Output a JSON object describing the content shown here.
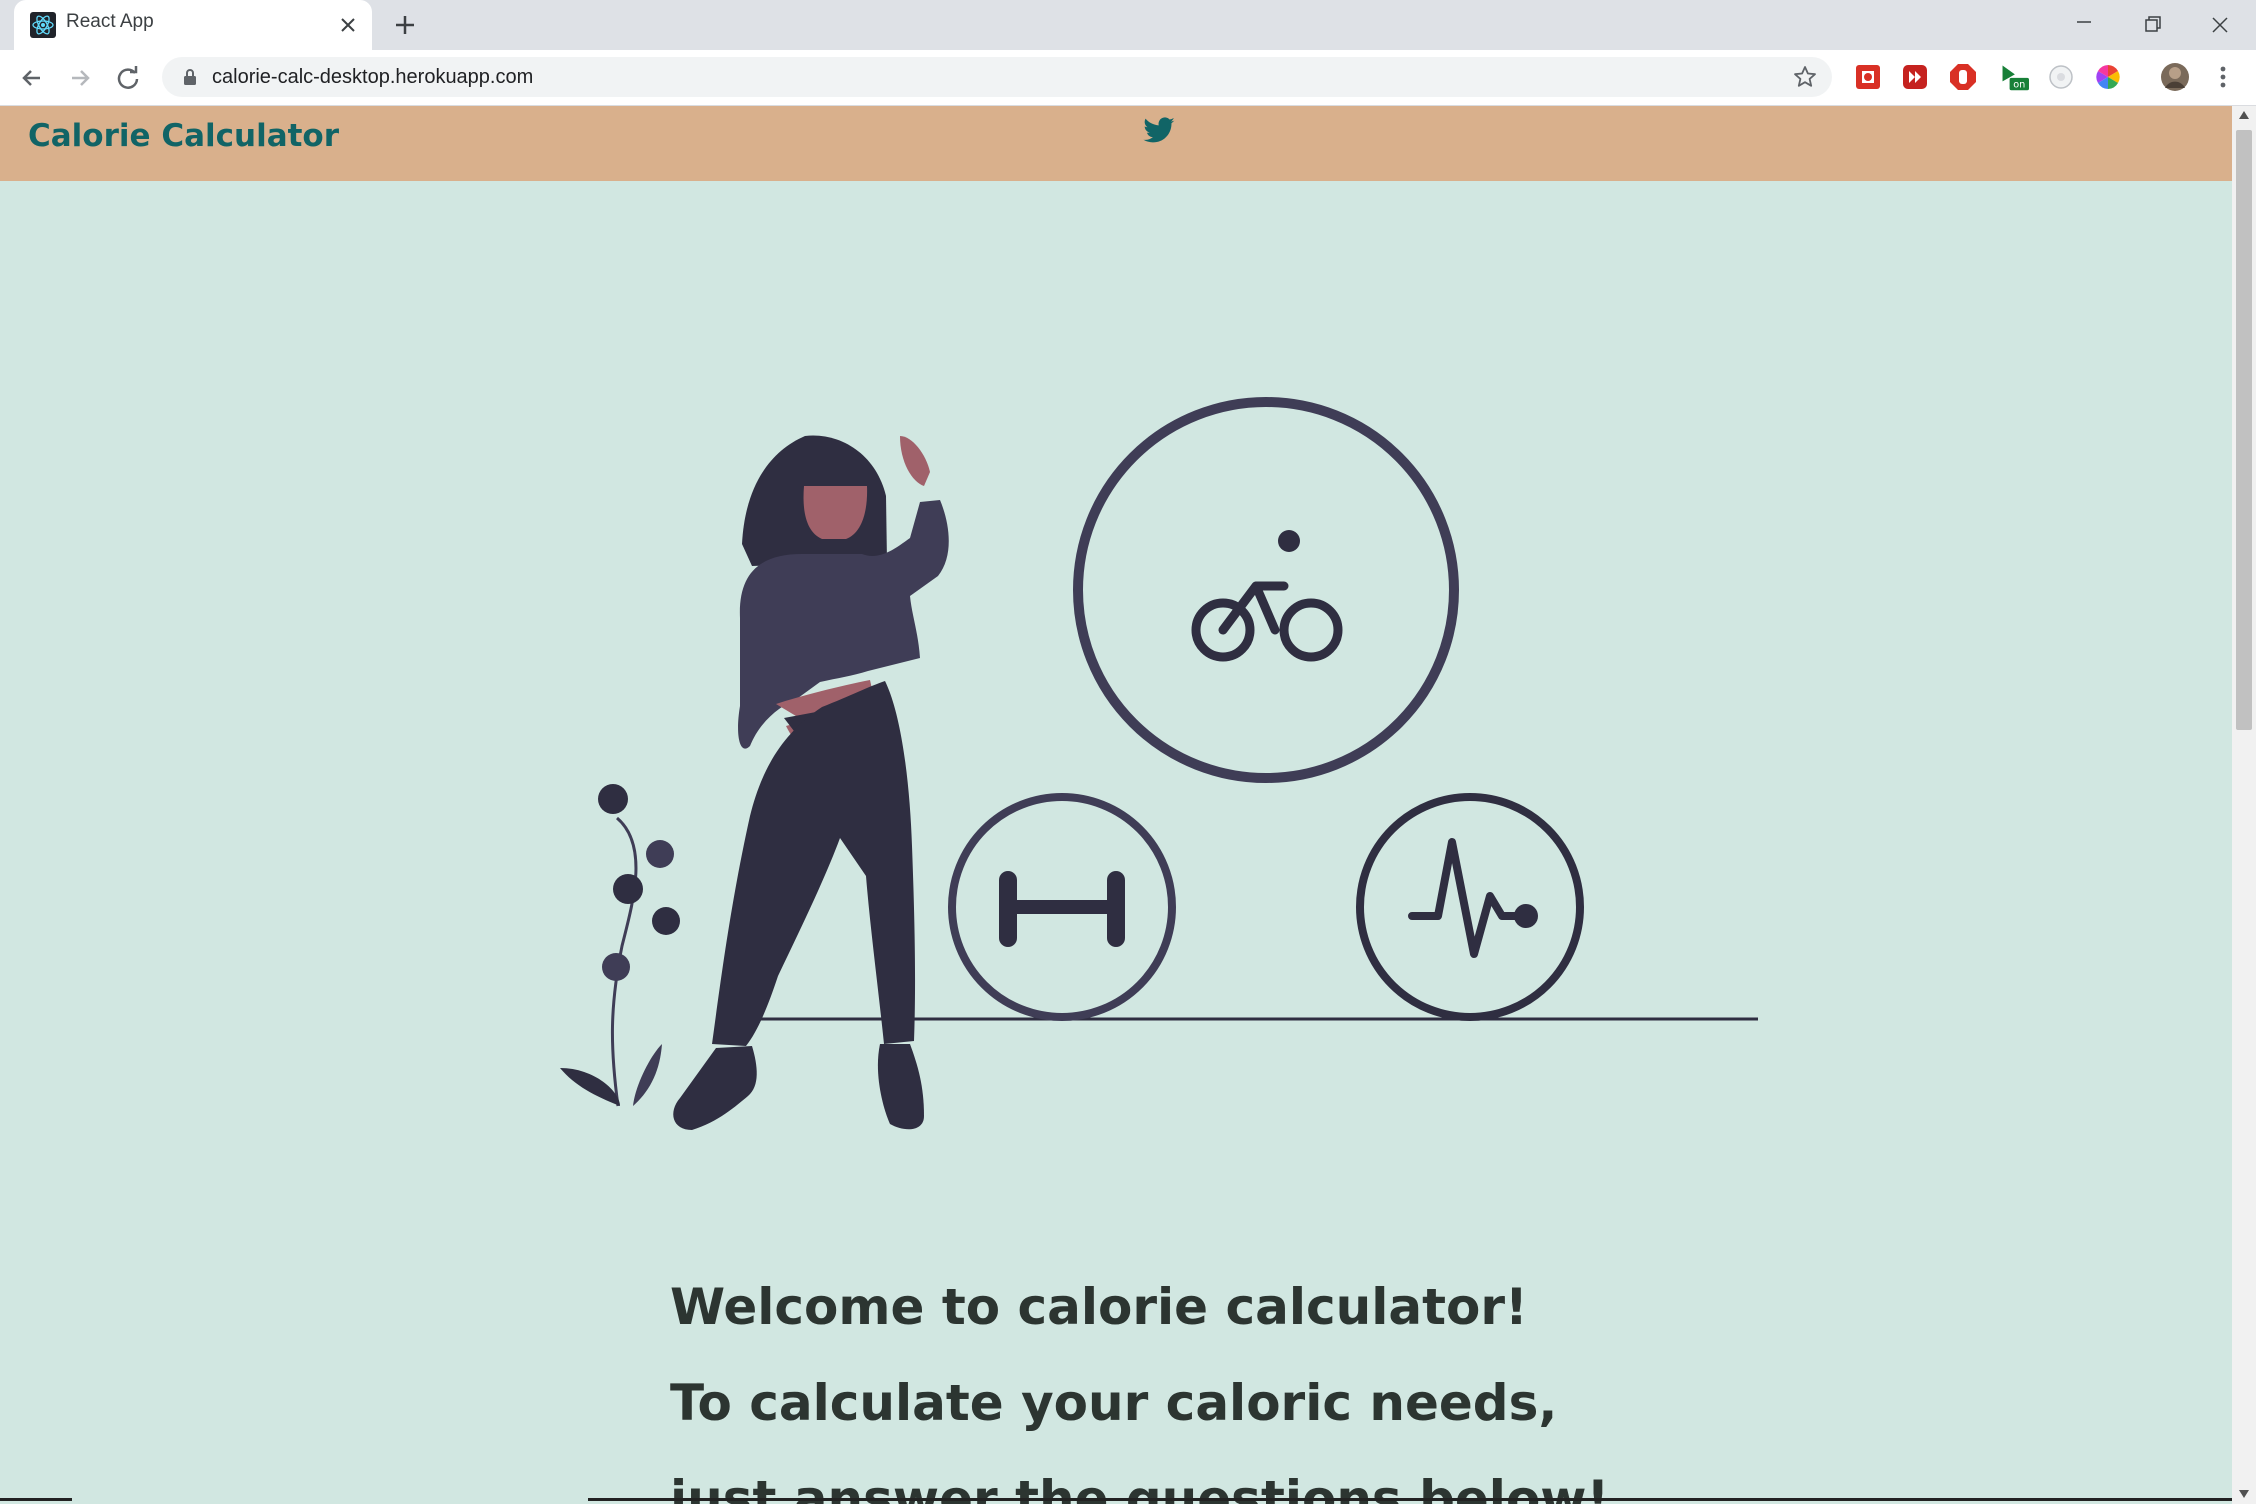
{
  "browser": {
    "tab_title": "React App",
    "url": "calorie-calc-desktop.herokuapp.com"
  },
  "header": {
    "brand": "Calorie Calculator"
  },
  "welcome": {
    "line1": "Welcome to calorie calculator!",
    "line2": "To calculate your caloric needs,",
    "line3": "just answer the questions below!"
  },
  "colors": {
    "header_bg": "#d9b08c",
    "page_bg": "#d1e7e1",
    "brand": "#116466",
    "text": "#2c3531"
  }
}
